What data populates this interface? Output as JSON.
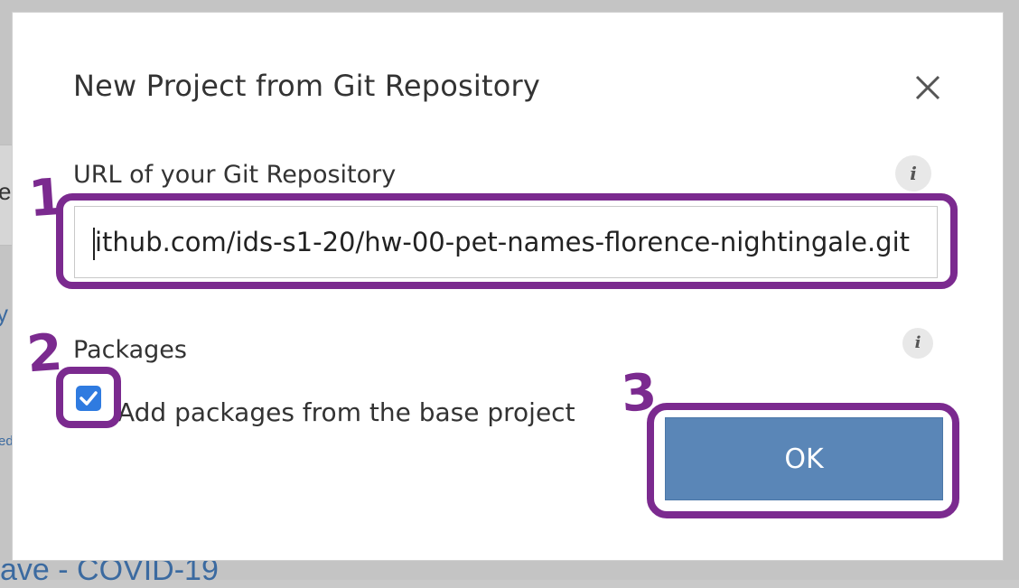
{
  "background": {
    "fragment_left": "e",
    "fragment_blue_1": "y",
    "fragment_small": "ed",
    "fragment_bottom": "ave - COVID-19"
  },
  "dialog": {
    "title": "New Project from Git Repository",
    "close_icon": "close-icon",
    "url_section": {
      "label": "URL of your Git Repository",
      "info_icon_glyph": "i",
      "value": "ithub.com/ids-s1-20/hw-00-pet-names-florence-nightingale.git"
    },
    "packages_section": {
      "label": "Packages",
      "info_icon_glyph": "i",
      "checkbox_checked": true,
      "checkbox_label": "Add packages from the base project"
    },
    "ok_button_label": "OK"
  },
  "annotations": {
    "step1": "1",
    "step2": "2",
    "step3": "3",
    "color": "#7b2a8f"
  },
  "colors": {
    "ok_button": "#5a86b7",
    "checkbox": "#2f7be0",
    "annotation": "#7b2a8f"
  }
}
